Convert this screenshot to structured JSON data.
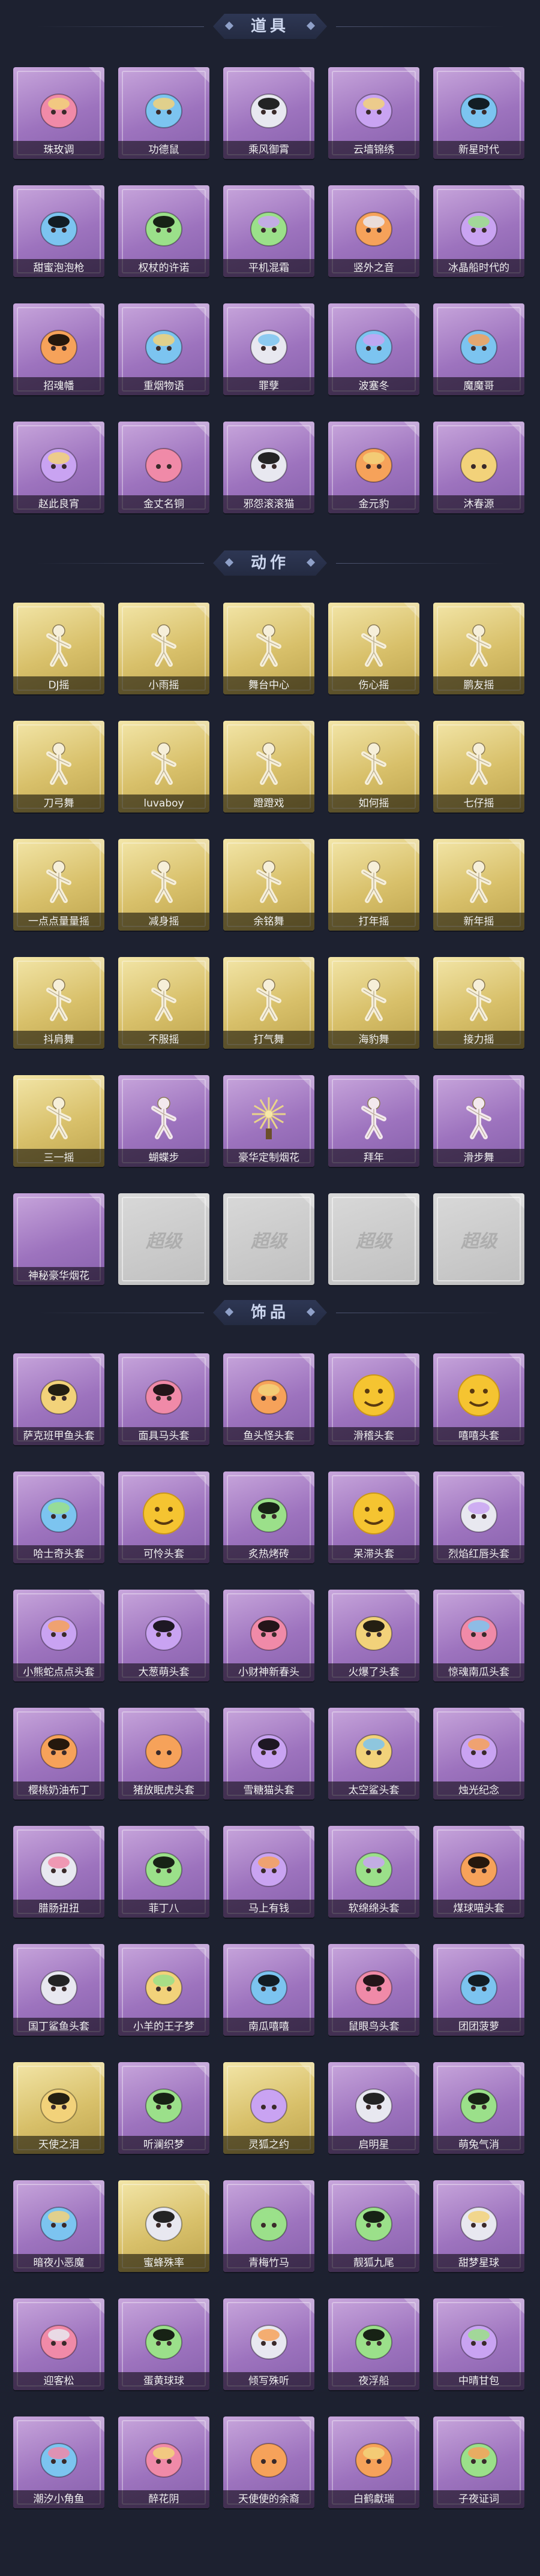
{
  "sections": [
    {
      "title": "道具",
      "items": [
        {
          "label": "珠玫调",
          "style": "purple",
          "icon": "rose-flower-icon"
        },
        {
          "label": "功德鼠",
          "style": "purple",
          "icon": "tiger-figure-icon"
        },
        {
          "label": "乘风御霄",
          "style": "purple",
          "icon": "blue-chariot-icon"
        },
        {
          "label": "云墙锦绣",
          "style": "purple",
          "icon": "ornament-fan-icon"
        },
        {
          "label": "新星时代",
          "style": "purple",
          "icon": "pistol-icon"
        },
        {
          "label": "甜蜜泡泡枪",
          "style": "purple",
          "icon": "bubble-gun-icon"
        },
        {
          "label": "权杖的许诺",
          "style": "purple",
          "icon": "scepter-icon"
        },
        {
          "label": "平机混霜",
          "style": "purple",
          "icon": "staff-icon"
        },
        {
          "label": "竖外之音",
          "style": "purple",
          "icon": "flute-icon"
        },
        {
          "label": "冰晶船时代的",
          "style": "purple",
          "icon": "ice-flower-icon"
        },
        {
          "label": "招魂幡",
          "style": "purple",
          "icon": "banner-icon"
        },
        {
          "label": "重烟物语",
          "style": "purple",
          "icon": "medkit-icon"
        },
        {
          "label": "罪孽",
          "style": "purple",
          "icon": "spear-icon"
        },
        {
          "label": "波塞冬",
          "style": "purple",
          "icon": "trident-icon"
        },
        {
          "label": "魔魔哥",
          "style": "purple",
          "icon": "doll-icon"
        },
        {
          "label": "赵此良宵",
          "style": "purple",
          "icon": "golden-fan-icon"
        },
        {
          "label": "金丈名铜",
          "style": "purple",
          "icon": "lantern-icon"
        },
        {
          "label": "邪怨滚滚猫",
          "style": "purple",
          "icon": "purple-lamp-icon"
        },
        {
          "label": "金元豹",
          "style": "purple",
          "icon": "lucky-cat-icon"
        },
        {
          "label": "沐春源",
          "style": "purple",
          "icon": "flower-staff-icon"
        }
      ]
    },
    {
      "title": "动作",
      "items": [
        {
          "label": "DJ摇",
          "style": "gold",
          "icon": "dance-pose-icon"
        },
        {
          "label": "小雨摇",
          "style": "gold",
          "icon": "dance-pose-icon"
        },
        {
          "label": "舞台中心",
          "style": "gold",
          "icon": "dance-pose-icon"
        },
        {
          "label": "伤心摇",
          "style": "gold",
          "icon": "dance-pose-icon"
        },
        {
          "label": "鹏友摇",
          "style": "gold",
          "icon": "dance-pose-icon"
        },
        {
          "label": "刀弓舞",
          "style": "gold",
          "icon": "dance-pose-icon"
        },
        {
          "label": "luvaboy",
          "style": "gold",
          "icon": "dance-pose-icon"
        },
        {
          "label": "蹬蹬戏",
          "style": "gold",
          "icon": "dance-pose-icon"
        },
        {
          "label": "如何摇",
          "style": "gold",
          "icon": "dance-pose-icon"
        },
        {
          "label": "七仔摇",
          "style": "gold",
          "icon": "dance-pose-icon"
        },
        {
          "label": "一点点量量摇",
          "style": "gold",
          "icon": "dance-pose-icon"
        },
        {
          "label": "减身摇",
          "style": "gold",
          "icon": "dance-pose-icon"
        },
        {
          "label": "余铭舞",
          "style": "gold",
          "icon": "dance-pose-icon"
        },
        {
          "label": "打年摇",
          "style": "gold",
          "icon": "dance-pose-icon"
        },
        {
          "label": "新年摇",
          "style": "gold",
          "icon": "dance-pose-icon"
        },
        {
          "label": "抖肩舞",
          "style": "gold",
          "icon": "dance-pose-icon"
        },
        {
          "label": "不服摇",
          "style": "gold",
          "icon": "dance-pose-icon"
        },
        {
          "label": "打气舞",
          "style": "gold",
          "icon": "dance-pose-icon"
        },
        {
          "label": "海豹舞",
          "style": "gold",
          "icon": "dance-pose-icon"
        },
        {
          "label": "接力摇",
          "style": "gold",
          "icon": "dance-pose-icon"
        },
        {
          "label": "三一摇",
          "style": "gold",
          "icon": "dance-pose-icon"
        },
        {
          "label": "蝴蝶步",
          "style": "purple",
          "icon": "dance-pose-icon"
        },
        {
          "label": "豪华定制烟花",
          "style": "purple",
          "icon": "firework-icon"
        },
        {
          "label": "拜年",
          "style": "purple",
          "icon": "dance-pose-icon"
        },
        {
          "label": "滑步舞",
          "style": "purple",
          "icon": "dance-pose-icon"
        },
        {
          "label": "神秘豪华烟花",
          "style": "purple",
          "icon": "none"
        },
        {
          "label": "",
          "style": "locked",
          "icon": "none"
        },
        {
          "label": "",
          "style": "locked",
          "icon": "none"
        },
        {
          "label": "",
          "style": "locked",
          "icon": "none"
        },
        {
          "label": "",
          "style": "locked",
          "icon": "none"
        }
      ]
    },
    {
      "title": "饰品",
      "items": [
        {
          "label": "萨克班甲鱼头套",
          "style": "purple",
          "icon": "fish-head-icon"
        },
        {
          "label": "面具马头套",
          "style": "purple",
          "icon": "horse-head-icon"
        },
        {
          "label": "鱼头怪头套",
          "style": "purple",
          "icon": "frog-head-icon"
        },
        {
          "label": "滑稽头套",
          "style": "purple",
          "icon": "smile-emoji-icon"
        },
        {
          "label": "嘻嘻头套",
          "style": "purple",
          "icon": "grin-emoji-icon"
        },
        {
          "label": "哈士奇头套",
          "style": "purple",
          "icon": "dog-head-icon"
        },
        {
          "label": "可怜头套",
          "style": "purple",
          "icon": "pout-emoji-icon"
        },
        {
          "label": "炙热烤砖",
          "style": "purple",
          "icon": "toast-head-icon"
        },
        {
          "label": "呆滞头套",
          "style": "purple",
          "icon": "dizzy-emoji-icon"
        },
        {
          "label": "烈焰红唇头套",
          "style": "purple",
          "icon": "pikachu-head-icon"
        },
        {
          "label": "小熊蛇点点头套",
          "style": "purple",
          "icon": "blob-head-icon"
        },
        {
          "label": "大葱萌头套",
          "style": "purple",
          "icon": "cabbage-head-icon"
        },
        {
          "label": "小财神新春头",
          "style": "purple",
          "icon": "poop-head-icon"
        },
        {
          "label": "火爆了头套",
          "style": "purple",
          "icon": "fire-head-icon"
        },
        {
          "label": "惊魂南瓜头套",
          "style": "purple",
          "icon": "pumpkin-head-icon"
        },
        {
          "label": "樱桃奶油布丁",
          "style": "purple",
          "icon": "pudding-head-icon"
        },
        {
          "label": "猪放眠虎头套",
          "style": "purple",
          "icon": "pig-head-icon"
        },
        {
          "label": "雪糖猫头套",
          "style": "purple",
          "icon": "snow-cat-icon"
        },
        {
          "label": "太空鲨头套",
          "style": "purple",
          "icon": "shark-head-icon"
        },
        {
          "label": "烛光纪念",
          "style": "purple",
          "icon": "candle-head-icon"
        },
        {
          "label": "腊肠扭扭",
          "style": "purple",
          "icon": "sausage-dog-icon"
        },
        {
          "label": "菲丁八",
          "style": "purple",
          "icon": "turnip-head-icon"
        },
        {
          "label": "马上有钱",
          "style": "purple",
          "icon": "horse-money-icon"
        },
        {
          "label": "软绵绵头套",
          "style": "purple",
          "icon": "cloud-head-icon"
        },
        {
          "label": "煤球喵头套",
          "style": "purple",
          "icon": "black-cat-icon"
        },
        {
          "label": "国丁鲨鱼头套",
          "style": "purple",
          "icon": "blue-dragon-icon"
        },
        {
          "label": "小羊的王子梦",
          "style": "purple",
          "icon": "sheep-head-icon"
        },
        {
          "label": "南瓜嘻嘻",
          "style": "purple",
          "icon": "green-ball-icon"
        },
        {
          "label": "鼠眼鸟头套",
          "style": "purple",
          "icon": "bird-head-icon"
        },
        {
          "label": "团团菠萝",
          "style": "purple",
          "icon": "yellow-cat-icon"
        },
        {
          "label": "天使之泪",
          "style": "gold",
          "icon": "angel-head-icon"
        },
        {
          "label": "听澜织梦",
          "style": "purple",
          "icon": "angel-wings-icon"
        },
        {
          "label": "灵狐之约",
          "style": "gold",
          "icon": "fox-head-icon"
        },
        {
          "label": "启明星",
          "style": "purple",
          "icon": "star-head-icon"
        },
        {
          "label": "萌兔气消",
          "style": "purple",
          "icon": "bunny-head-icon"
        },
        {
          "label": "暗夜小恶魔",
          "style": "purple",
          "icon": "devil-head-icon"
        },
        {
          "label": "蜜蜂殊率",
          "style": "gold",
          "icon": "pink-bee-icon"
        },
        {
          "label": "青梅竹马",
          "style": "purple",
          "icon": "pink-horse-icon"
        },
        {
          "label": "靓狐九尾",
          "style": "purple",
          "icon": "nine-tail-fox-icon"
        },
        {
          "label": "甜梦星球",
          "style": "purple",
          "icon": "moon-head-icon"
        },
        {
          "label": "迎客松",
          "style": "purple",
          "icon": "bonsai-head-icon"
        },
        {
          "label": "蛋黄球球",
          "style": "purple",
          "icon": "egg-chick-icon"
        },
        {
          "label": "倾写殊听",
          "style": "purple",
          "icon": "flower-wreath-icon"
        },
        {
          "label": "夜浮船",
          "style": "purple",
          "icon": "ice-crown-icon"
        },
        {
          "label": "中晴甘包",
          "style": "purple",
          "icon": "pig-chef-icon"
        },
        {
          "label": "潮汐小角鱼",
          "style": "purple",
          "icon": "blue-axolotl-icon"
        },
        {
          "label": "醉花阴",
          "style": "purple",
          "icon": "phoenix-crown-icon"
        },
        {
          "label": "天使使的余裔",
          "style": "purple",
          "icon": "angel-cape-icon"
        },
        {
          "label": "白鹤獻瑞",
          "style": "purple",
          "icon": "white-crane-icon"
        },
        {
          "label": "子夜证词",
          "style": "purple",
          "icon": "dark-hair-icon"
        }
      ]
    }
  ],
  "locked_watermark": "超级",
  "colors": {
    "background": "#1d2130",
    "purple_card": "#9d73be",
    "gold_card": "#d8c06a",
    "locked_card": "#c9c9c9"
  }
}
